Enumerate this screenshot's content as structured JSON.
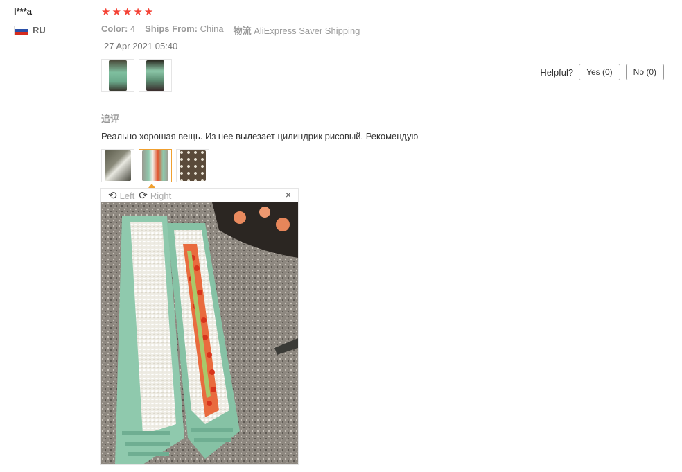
{
  "review": {
    "user": "l***a",
    "country": "RU",
    "rating": 5,
    "attrs": [
      {
        "key": "Color:",
        "value": "4"
      },
      {
        "key": "Ships From:",
        "value": "China"
      },
      {
        "key": "物流",
        "value": "AliExpress Saver Shipping"
      }
    ],
    "date": "27 Apr 2021 05:40",
    "helpful_label": "Helpful?",
    "yes_label": "Yes (0)",
    "no_label": "No (0)"
  },
  "additional": {
    "title": "追评",
    "text": "Реально хорошая вещь. Из нее вылезает цилиндрик рисовый. Рекомендую"
  },
  "viewer": {
    "left_label": "Left",
    "right_label": "Right",
    "close_symbol": "×"
  },
  "colors": {
    "star": "#f44336",
    "selected_border": "#f0a030",
    "mold": "#8fc9ad"
  }
}
